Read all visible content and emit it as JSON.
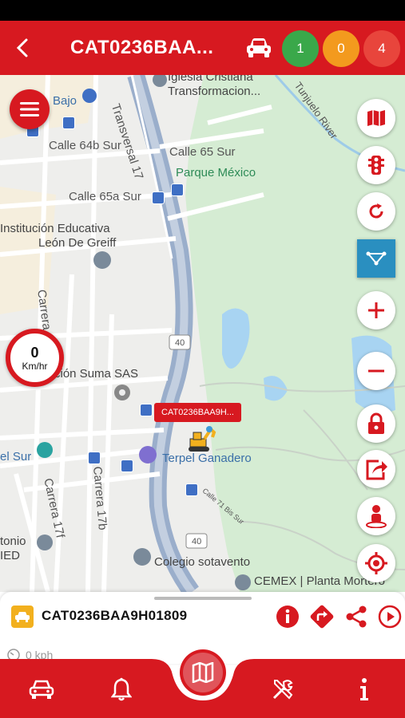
{
  "header": {
    "title": "CAT0236BAA...",
    "back_icon": "chevron-left-icon",
    "vehicle_icon": "car-icon",
    "status_counts": [
      {
        "value": "1",
        "color": "#3aa84a"
      },
      {
        "value": "0",
        "color": "#f39a1e"
      },
      {
        "value": "4",
        "color": "#e8453c"
      }
    ]
  },
  "map": {
    "labels": {
      "bajo": "Bajo",
      "iglesia_1": "Iglesia Cristiana",
      "iglesia_2": "Transformacion...",
      "river": "Tunjuelo River",
      "calle_64b": "Calle 64b Sur",
      "transversal": "Transversal 17",
      "calle_65": "Calle 65 Sur",
      "parque": "Parque México",
      "calle_65a": "Calle 65a Sur",
      "institucion_1": "Institución Educativa",
      "institucion_2": "León De Greiff",
      "carrera_18": "Carrera 18",
      "suma": "ción Suma SAS",
      "road_40a": "40",
      "terpel": "Terpel Ganadero",
      "el_sur": "el Sur",
      "carrera_17f": "Carrera 17f",
      "carrera_17b": "Carrera 17b",
      "calle_71": "Calle 71 Bis Sur",
      "road_40b": "40",
      "antonio_1": "tonio",
      "antonio_2": "IED",
      "colegio": "Colegio sotavento",
      "cemex": "CEMEX | Planta Mortero"
    },
    "vehicle_label": "CAT0236BAA9H...",
    "speed": {
      "value": "0",
      "unit": "Km/hr"
    }
  },
  "side_buttons": [
    {
      "name": "map-layers",
      "icon": "map-icon"
    },
    {
      "name": "traffic",
      "icon": "traffic-light-icon"
    },
    {
      "name": "refresh",
      "icon": "refresh-icon"
    },
    {
      "name": "geofence",
      "icon": "geofence-icon"
    },
    {
      "name": "zoom-in",
      "icon": "plus-icon"
    },
    {
      "name": "zoom-out",
      "icon": "minus-icon"
    },
    {
      "name": "lock",
      "icon": "lock-icon"
    },
    {
      "name": "share",
      "icon": "share-box-icon"
    },
    {
      "name": "street-view",
      "icon": "person-pin-icon"
    },
    {
      "name": "my-location",
      "icon": "crosshair-icon"
    }
  ],
  "sheet": {
    "vehicle_id": "CAT0236BAA9H01809",
    "speed_text": "0 kph",
    "actions": [
      "info-icon",
      "directions-icon",
      "share-icon",
      "play-icon"
    ]
  },
  "bottom_nav": {
    "items": [
      "car-icon",
      "bell-icon",
      "map-icon",
      "tools-icon",
      "info-icon"
    ]
  }
}
